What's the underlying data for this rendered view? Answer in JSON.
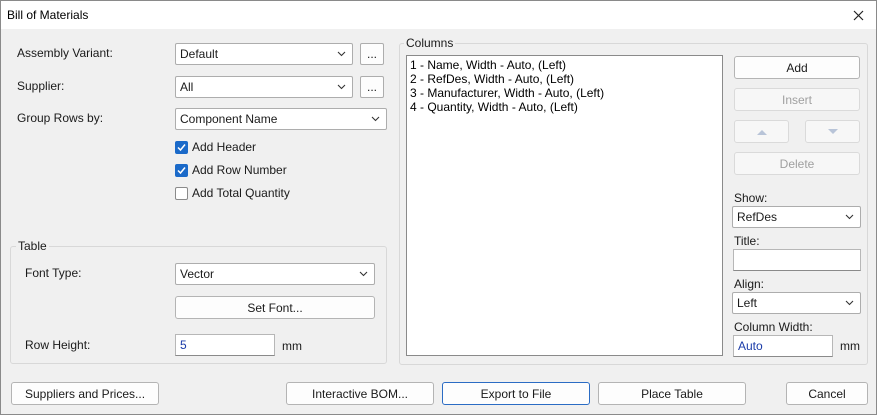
{
  "window": {
    "title": "Bill of Materials"
  },
  "form": {
    "assembly_variant": {
      "label": "Assembly Variant:",
      "value": "Default"
    },
    "supplier": {
      "label": "Supplier:",
      "value": "All"
    },
    "group_rows_by": {
      "label": "Group Rows by:",
      "value": "Component Name"
    },
    "ellipsis": "...",
    "add_header": {
      "label": "Add Header",
      "checked": true
    },
    "add_row_number": {
      "label": "Add Row Number",
      "checked": true
    },
    "add_total_quantity": {
      "label": "Add Total Quantity",
      "checked": false
    }
  },
  "table_group": {
    "label": "Table",
    "font_type": {
      "label": "Font Type:",
      "value": "Vector"
    },
    "set_font_button": "Set Font...",
    "row_height": {
      "label": "Row Height:",
      "value": "5",
      "unit": "mm"
    }
  },
  "columns_group": {
    "label": "Columns",
    "items": [
      "1 - Name, Width - Auto, (Left)",
      "2 - RefDes, Width - Auto, (Left)",
      "3 - Manufacturer, Width - Auto, (Left)",
      "4 - Quantity, Width - Auto, (Left)"
    ],
    "add_button": "Add",
    "insert_button": "Insert",
    "delete_button": "Delete",
    "show": {
      "label": "Show:",
      "value": "RefDes"
    },
    "title": {
      "label": "Title:",
      "value": ""
    },
    "align": {
      "label": "Align:",
      "value": "Left"
    },
    "column_width": {
      "label": "Column Width:",
      "value": "Auto",
      "unit": "mm"
    }
  },
  "footer": {
    "suppliers_button": "Suppliers and Prices...",
    "interactive_bom_button": "Interactive BOM...",
    "export_button": "Export to File",
    "place_table_button": "Place Table",
    "cancel_button": "Cancel"
  },
  "colors": {
    "accent": "#1b6ac9",
    "focus_border": "#2b6cc4"
  }
}
